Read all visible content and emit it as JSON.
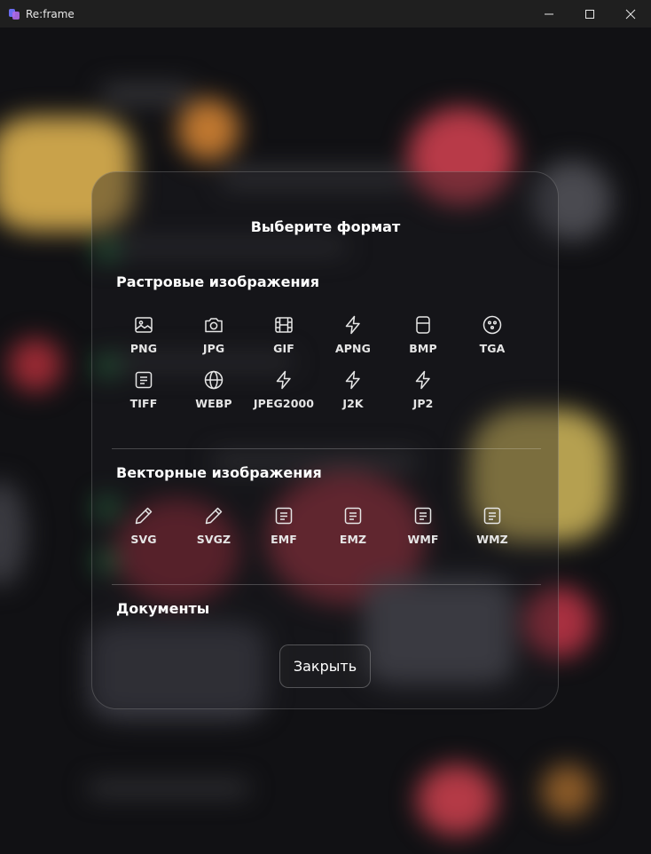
{
  "window": {
    "title": "Re:frame"
  },
  "dialog": {
    "title": "Выберите формат",
    "close_label": "Закрыть"
  },
  "sections": {
    "raster": {
      "title": "Растровые изображения",
      "items": [
        {
          "label": "PNG",
          "icon": "image-icon"
        },
        {
          "label": "JPG",
          "icon": "camera-icon"
        },
        {
          "label": "GIF",
          "icon": "film-icon"
        },
        {
          "label": "APNG",
          "icon": "lightning-icon"
        },
        {
          "label": "BMP",
          "icon": "square-icon"
        },
        {
          "label": "TGA",
          "icon": "palette-icon"
        },
        {
          "label": "TIFF",
          "icon": "document-icon"
        },
        {
          "label": "WEBP",
          "icon": "globe-icon"
        },
        {
          "label": "JPEG2000",
          "icon": "lightning-icon"
        },
        {
          "label": "J2K",
          "icon": "lightning-icon"
        },
        {
          "label": "JP2",
          "icon": "lightning-icon"
        }
      ]
    },
    "vector": {
      "title": "Векторные изображения",
      "items": [
        {
          "label": "SVG",
          "icon": "pen-icon"
        },
        {
          "label": "SVGZ",
          "icon": "pen-icon"
        },
        {
          "label": "EMF",
          "icon": "document-icon"
        },
        {
          "label": "EMZ",
          "icon": "document-icon"
        },
        {
          "label": "WMF",
          "icon": "document-icon"
        },
        {
          "label": "WMZ",
          "icon": "document-icon"
        }
      ]
    },
    "documents": {
      "title": "Документы"
    }
  }
}
